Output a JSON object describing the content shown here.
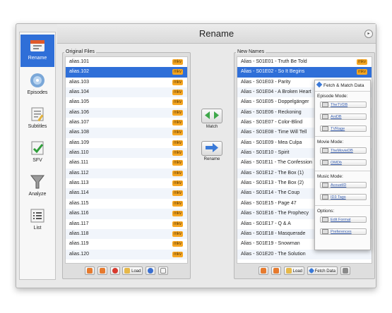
{
  "window": {
    "title": "Rename"
  },
  "sidebar": {
    "items": [
      {
        "label": "Rename",
        "icon": "rename-icon"
      },
      {
        "label": "Episodes",
        "icon": "episodes-icon"
      },
      {
        "label": "Subtitles",
        "icon": "subtitles-icon"
      },
      {
        "label": "SFV",
        "icon": "sfv-icon"
      },
      {
        "label": "Analyze",
        "icon": "analyze-icon"
      },
      {
        "label": "List",
        "icon": "list-icon"
      }
    ]
  },
  "original_files": {
    "label": "Original Files",
    "items": [
      {
        "name": "alias.101",
        "ext": "mkv"
      },
      {
        "name": "alias.102",
        "ext": "mkv"
      },
      {
        "name": "alias.103",
        "ext": "mkv"
      },
      {
        "name": "alias.104",
        "ext": "mkv"
      },
      {
        "name": "alias.105",
        "ext": "mkv"
      },
      {
        "name": "alias.106",
        "ext": "mkv"
      },
      {
        "name": "alias.107",
        "ext": "mkv"
      },
      {
        "name": "alias.108",
        "ext": "mkv"
      },
      {
        "name": "alias.109",
        "ext": "mkv"
      },
      {
        "name": "alias.110",
        "ext": "mkv"
      },
      {
        "name": "alias.111",
        "ext": "mkv"
      },
      {
        "name": "alias.112",
        "ext": "mkv"
      },
      {
        "name": "alias.113",
        "ext": "mkv"
      },
      {
        "name": "alias.114",
        "ext": "mkv"
      },
      {
        "name": "alias.115",
        "ext": "mkv"
      },
      {
        "name": "alias.116",
        "ext": "mkv"
      },
      {
        "name": "alias.117",
        "ext": "mkv"
      },
      {
        "name": "alias.118",
        "ext": "mkv"
      },
      {
        "name": "alias.119",
        "ext": "mkv"
      },
      {
        "name": "alias.120",
        "ext": "mkv"
      }
    ],
    "toolbar": {
      "load_label": "Load"
    }
  },
  "new_names": {
    "label": "New Names",
    "items": [
      {
        "name": "Alias - S01E01 - Truth Be Told",
        "ext": "mkv"
      },
      {
        "name": "Alias - S01E02 - So It Begins",
        "ext": "mkv"
      },
      {
        "name": "Alias - S01E03 - Parity",
        "ext": ""
      },
      {
        "name": "Alias - S01E04 - A Broken Heart",
        "ext": ""
      },
      {
        "name": "Alias - S01E05 - Doppelgänger",
        "ext": ""
      },
      {
        "name": "Alias - S01E06 - Reckoning",
        "ext": ""
      },
      {
        "name": "Alias - S01E07 - Color-Blind",
        "ext": ""
      },
      {
        "name": "Alias - S01E08 - Time Will Tell",
        "ext": ""
      },
      {
        "name": "Alias - S01E09 - Mea Culpa",
        "ext": ""
      },
      {
        "name": "Alias - S01E10 - Spirit",
        "ext": ""
      },
      {
        "name": "Alias - S01E11 - The Confession",
        "ext": ""
      },
      {
        "name": "Alias - S01E12 - The Box (1)",
        "ext": ""
      },
      {
        "name": "Alias - S01E13 - The Box (2)",
        "ext": ""
      },
      {
        "name": "Alias - S01E14 - The Coup",
        "ext": ""
      },
      {
        "name": "Alias - S01E15 - Page 47",
        "ext": ""
      },
      {
        "name": "Alias - S01E16 - The Prophecy",
        "ext": ""
      },
      {
        "name": "Alias - S01E17 - Q & A",
        "ext": ""
      },
      {
        "name": "Alias - S01E18 - Masquerade",
        "ext": ""
      },
      {
        "name": "Alias - S01E19 - Snowman",
        "ext": ""
      },
      {
        "name": "Alias - S01E20 - The Solution",
        "ext": ""
      }
    ],
    "toolbar": {
      "load_label": "Load",
      "fetch_label": "Fetch Data"
    }
  },
  "actions": {
    "match_label": "Match",
    "rename_label": "Rename"
  },
  "popup": {
    "title": "Fetch & Match Data",
    "episode_mode_label": "Episode Mode:",
    "episode_sources": [
      "TheTVDB",
      "AniDB",
      "TVRage"
    ],
    "movie_mode_label": "Movie Mode:",
    "movie_sources": [
      "TheMovieDB",
      "OMDb"
    ],
    "music_mode_label": "Music Mode:",
    "music_sources": [
      "AcoustID",
      "ID3 Tags"
    ],
    "options_label": "Options:",
    "options": [
      "Edit Format",
      "Preferences"
    ]
  },
  "colors": {
    "selection": "#2f6fd8",
    "badge": "#f5a623"
  }
}
